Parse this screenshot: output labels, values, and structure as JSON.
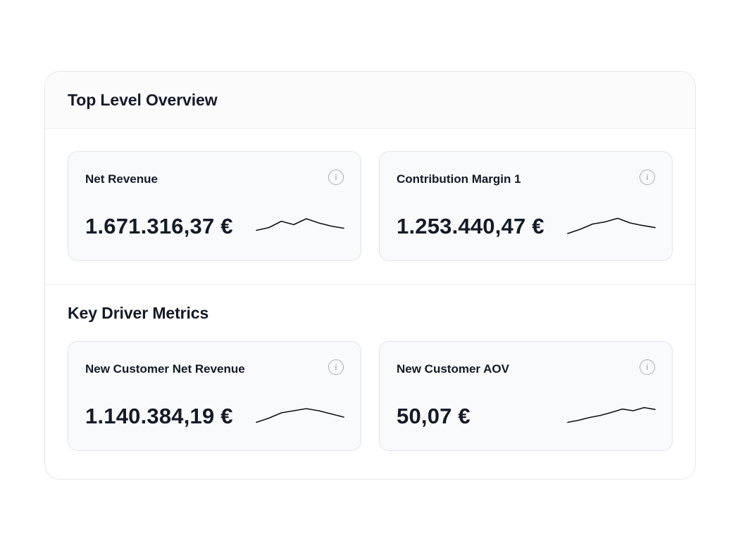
{
  "sections": [
    {
      "title": "Top Level Overview",
      "cards": [
        {
          "label": "Net Revenue",
          "value": "1.671.316,37 €",
          "trend": [
            0.25,
            0.38,
            0.68,
            0.52,
            0.8,
            0.6,
            0.45,
            0.35
          ]
        },
        {
          "label": "Contribution Margin 1",
          "value": "1.253.440,47 €",
          "trend": [
            0.1,
            0.3,
            0.55,
            0.65,
            0.82,
            0.6,
            0.48,
            0.38
          ]
        }
      ]
    },
    {
      "title": "Key Driver Metrics",
      "cards": [
        {
          "label": "New Customer Net Revenue",
          "value": "1.140.384,19 €",
          "trend": [
            0.15,
            0.35,
            0.6,
            0.7,
            0.8,
            0.7,
            0.55,
            0.4
          ]
        },
        {
          "label": "New Customer AOV",
          "value": "50,07 €",
          "trend": [
            0.15,
            0.25,
            0.38,
            0.48,
            0.62,
            0.78,
            0.7,
            0.85,
            0.76
          ]
        }
      ]
    }
  ],
  "icons": {
    "info": "info-icon",
    "info_glyph": "i"
  },
  "colors": {
    "text": "#141a26",
    "card_bg": "#f8fafc",
    "border": "#e1e4e8",
    "sparkline": "#111111"
  }
}
